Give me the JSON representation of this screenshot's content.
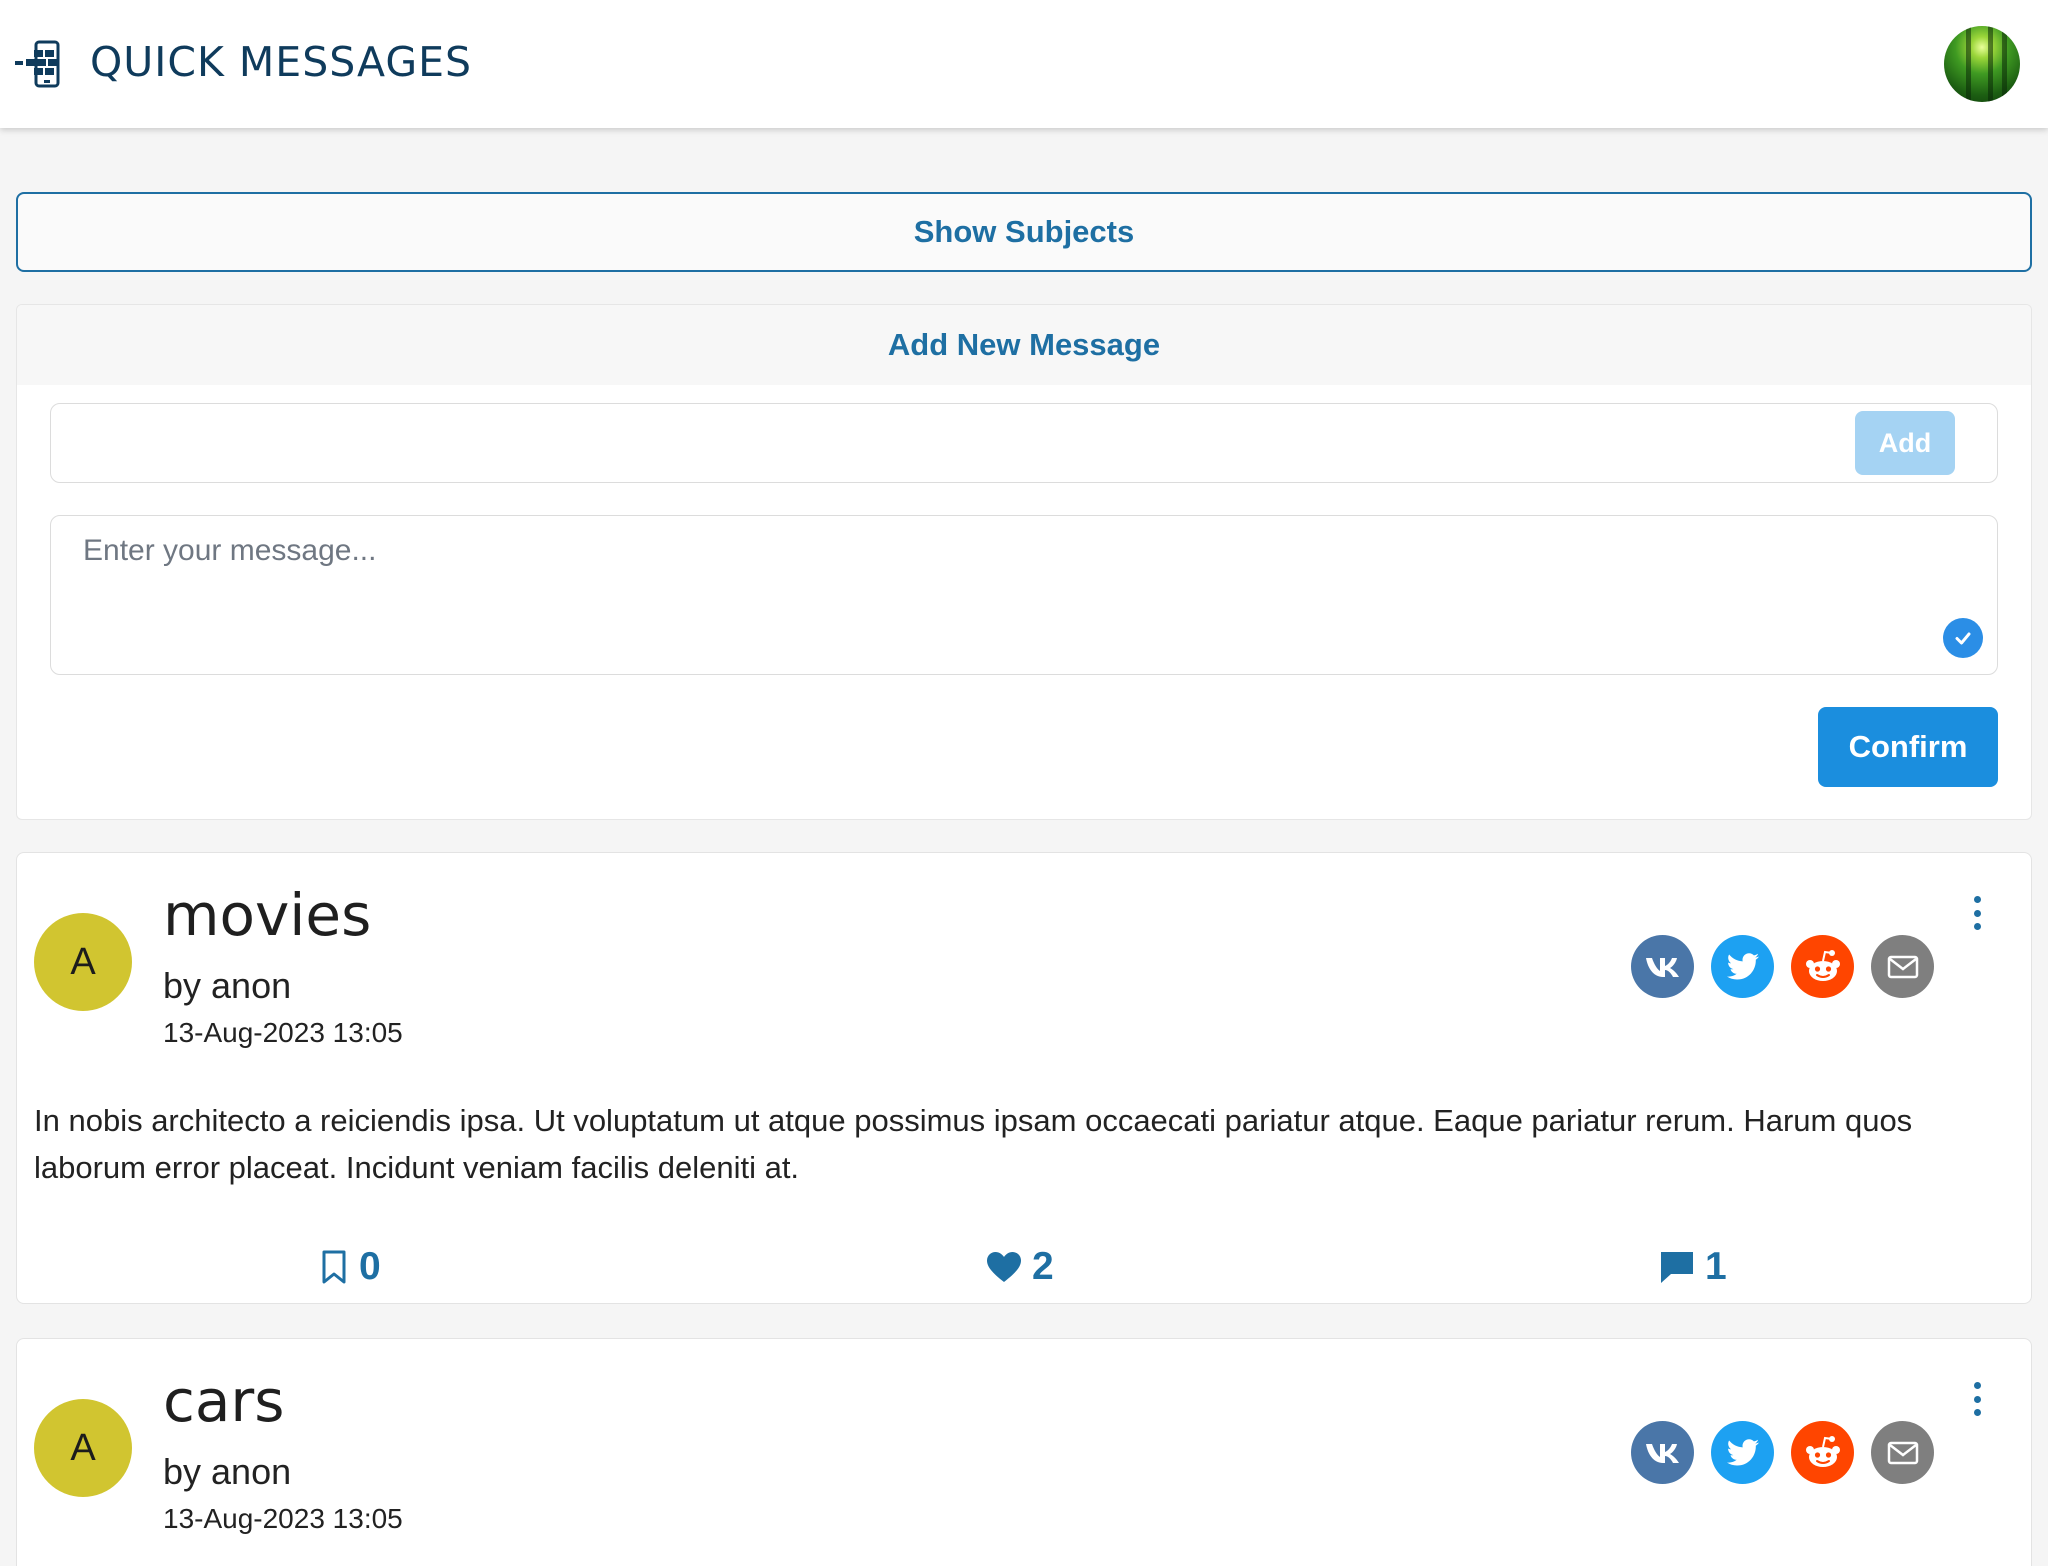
{
  "header": {
    "title": "QUICK MESSAGES",
    "logo_icon": "messages-logo-icon",
    "avatar_icon": "user-avatar-icon"
  },
  "subjects": {
    "toggle_label": "Show Subjects"
  },
  "new_message": {
    "header": "Add New Message",
    "subject_value": "",
    "add_label": "Add",
    "message_placeholder": "Enter your message...",
    "confirm_label": "Confirm"
  },
  "colors": {
    "accent": "#1e6fa3",
    "confirm": "#1b8ede",
    "avatar": "#d1c530",
    "vk": "#4a76a8",
    "twitter": "#1da1f2",
    "reddit": "#ff4500",
    "email": "#7f7f7f"
  },
  "share_icons": [
    "vk-icon",
    "twitter-icon",
    "reddit-icon",
    "email-icon"
  ],
  "messages": [
    {
      "avatar_letter": "A",
      "subject": "movies",
      "author": "by anon",
      "date": "13-Aug-2023 13:05",
      "body": "In nobis architecto a reiciendis ipsa. Ut voluptatum ut atque possimus ipsam occaecati pariatur atque. Eaque pariatur rerum. Harum quos laborum error placeat. Incidunt veniam facilis deleniti at.",
      "bookmarks": "0",
      "likes": "2",
      "comments": "1"
    },
    {
      "avatar_letter": "A",
      "subject": "cars",
      "author": "by anon",
      "date": "13-Aug-2023 13:05"
    }
  ]
}
